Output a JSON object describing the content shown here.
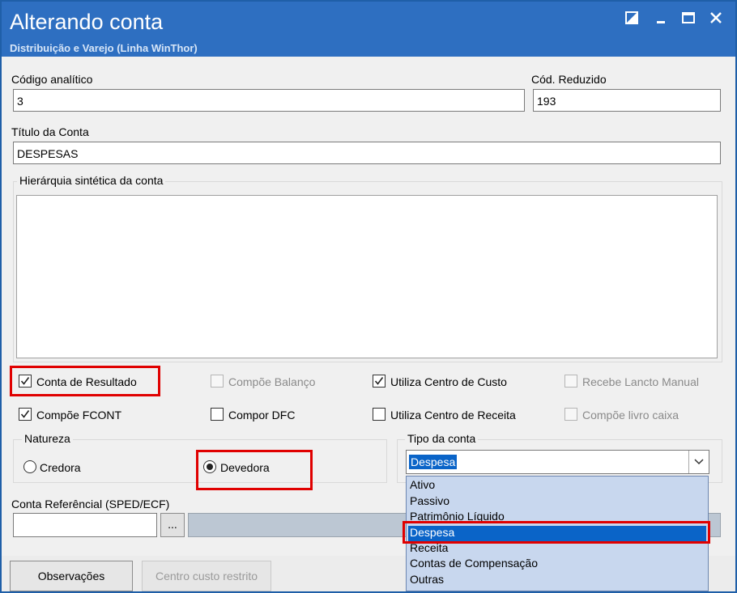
{
  "window": {
    "title": "Alterando conta",
    "subtitle": "Distribuição e Varejo (Linha WinThor)",
    "controls": [
      "restore-icon",
      "minimize-icon",
      "maximize-icon",
      "close-icon"
    ]
  },
  "fields": {
    "codigo_analitico": {
      "label": "Código analítico",
      "value": "3"
    },
    "cod_reduzido": {
      "label": "Cód. Reduzido",
      "value": "193"
    },
    "titulo_conta": {
      "label": "Título da Conta",
      "value": "DESPESAS"
    },
    "hierarquia": {
      "label": "Hierárquia sintética da conta",
      "value": ""
    }
  },
  "checkboxes": [
    {
      "label": "Conta de Resultado",
      "checked": true,
      "enabled": true
    },
    {
      "label": "Compõe Balanço",
      "checked": false,
      "enabled": false
    },
    {
      "label": "Utiliza Centro de Custo",
      "checked": true,
      "enabled": true
    },
    {
      "label": "Recebe Lancto Manual",
      "checked": false,
      "enabled": false
    },
    {
      "label": "Compõe FCONT",
      "checked": true,
      "enabled": true
    },
    {
      "label": "Compor DFC",
      "checked": false,
      "enabled": true
    },
    {
      "label": "Utiliza Centro de Receita",
      "checked": false,
      "enabled": true
    },
    {
      "label": "Compõe livro caixa",
      "checked": false,
      "enabled": false
    }
  ],
  "natureza": {
    "title": "Natureza",
    "options": [
      {
        "label": "Credora",
        "selected": false
      },
      {
        "label": "Devedora",
        "selected": true
      }
    ]
  },
  "tipo_conta": {
    "title": "Tipo da conta",
    "selected": "Despesa",
    "options": [
      "Ativo",
      "Passivo",
      "Patrimônio Líquido",
      "Despesa",
      "Receita",
      "Contas de Compensação",
      "Outras"
    ],
    "highlighted_index": 3
  },
  "conta_referencial": {
    "label": "Conta Referêncial (SPED/ECF)",
    "value": "",
    "browse_label": "..."
  },
  "buttons": {
    "observacoes": "Observações",
    "centro_custo_restrito": "Centro custo restrito"
  },
  "colors": {
    "titlebar": "#2e6fc1",
    "highlight_annotation": "#e00000",
    "selection": "#0a64c8",
    "dropdown_bg": "#c8d7ee"
  }
}
